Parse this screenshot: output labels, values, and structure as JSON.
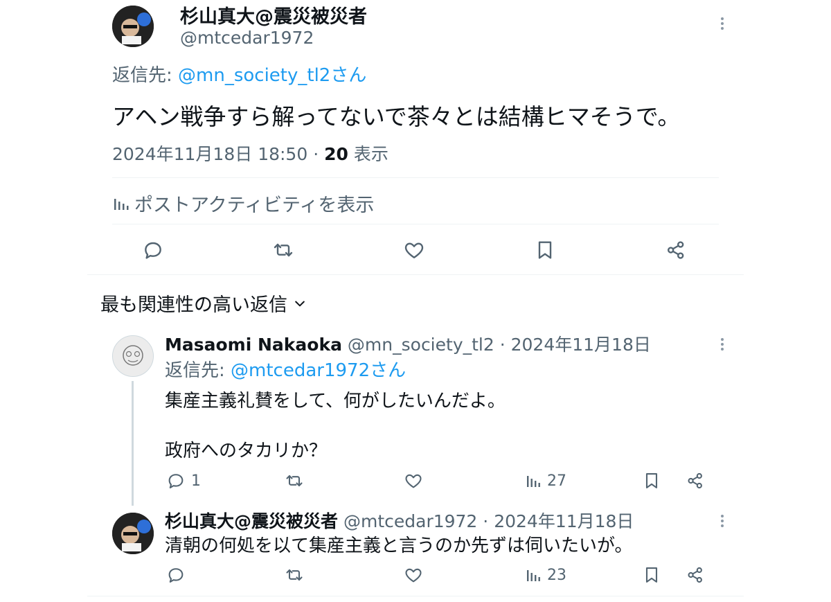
{
  "main_tweet": {
    "display_name": "杉山真大@震災被災者",
    "handle": "@mtcedar1972",
    "reply_prefix": "返信先:",
    "reply_to": "@mn_society_tl2さん",
    "text": "アヘン戦争すら解ってないで茶々とは結構ヒマそうで。",
    "timestamp": "2024年11月18日 18:50",
    "separator": "·",
    "views_count": "20",
    "views_label": "表示",
    "activity_link": "ポストアクティビティを表示"
  },
  "sort": {
    "label": "最も関連性の高い返信"
  },
  "replies": [
    {
      "display_name": "Masaomi Nakaoka",
      "handle": "@mn_society_tl2",
      "date": "· 2024年11月18日",
      "reply_prefix": "返信先:",
      "reply_to": "@mtcedar1972さん",
      "line1": "集産主義礼賛をして、何がしたいんだよ。",
      "line2": "政府へのタカリか？",
      "reply_count": "1",
      "views": "27"
    },
    {
      "display_name": "杉山真大@震災被災者",
      "handle": "@mtcedar1972",
      "date": "· 2024年11月18日",
      "line1": "清朝の何処を以て集産主義と言うのか先ずは伺いたいが。",
      "views": "23"
    }
  ],
  "colors": {
    "text": "#0f1419",
    "muted": "#536471",
    "link": "#1d9bf0",
    "divider": "#eff3f4"
  }
}
